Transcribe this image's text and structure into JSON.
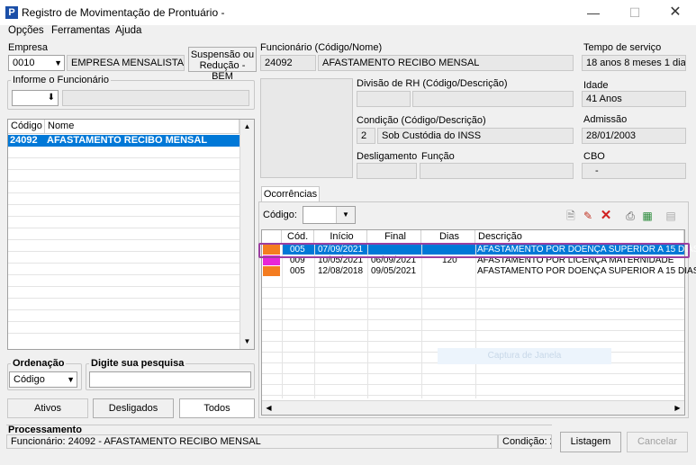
{
  "window": {
    "title": "Registro de Movimentação de Prontuário -",
    "app_letter": "P"
  },
  "menu": [
    "Opções",
    "Ferramentas",
    "Ajuda"
  ],
  "empresa": {
    "label": "Empresa",
    "code": "0010",
    "name": "EMPRESA MENSALISTA"
  },
  "suspensao_button": {
    "line1": "Suspensão ou",
    "line2": "Redução - BEM"
  },
  "funcionario": {
    "label": "Funcionário (Código/Nome)",
    "code": "24092",
    "name": "AFASTAMENTO RECIBO MENSAL"
  },
  "tempo_servico": {
    "label": "Tempo de serviço",
    "value": "18 anos 8 meses 1 dia"
  },
  "informe": {
    "label": "Informe o Funcionário"
  },
  "divisao": {
    "label": "Divisão de RH (Código/Descrição)"
  },
  "idade": {
    "label": "Idade",
    "value": "41 Anos"
  },
  "condicao": {
    "label": "Condição (Código/Descrição)",
    "code": "2",
    "desc": "Sob Custódia do INSS"
  },
  "admissao": {
    "label": "Admissão",
    "value": "28/01/2003"
  },
  "desligamento": {
    "label": "Desligamento"
  },
  "funcao": {
    "label": "Função"
  },
  "cbo": {
    "label": "CBO",
    "value": "-"
  },
  "employee_list": {
    "headers": [
      "Código",
      "Nome"
    ],
    "rows": [
      {
        "code": "24092",
        "name": "AFASTAMENTO RECIBO MENSAL"
      }
    ]
  },
  "ordenacao": {
    "label": "Ordenação",
    "value": "Código"
  },
  "pesquisa": {
    "label": "Digite sua pesquisa"
  },
  "filter_buttons": [
    "Ativos",
    "Desligados",
    "Todos"
  ],
  "ocorrencias": {
    "tab": "Ocorrências",
    "codigo_label": "Código:",
    "headers": [
      "Cód.",
      "Início",
      "Final",
      "Dias",
      "Descrição"
    ],
    "rows": [
      {
        "color": "#f47c20",
        "cod": "005",
        "inicio": "07/09/2021",
        "final": "",
        "dias": "",
        "desc": "AFASTAMENTO POR DOENÇA SUPERIOR A 15 DIAS"
      },
      {
        "color": "#e826d6",
        "cod": "009",
        "inicio": "10/05/2021",
        "final": "06/09/2021",
        "dias": "120",
        "desc": "AFASTAMENTO POR LICENÇA MATERNIDADE"
      },
      {
        "color": "#f47c20",
        "cod": "005",
        "inicio": "12/08/2018",
        "final": "09/05/2021",
        "dias": "",
        "desc": "AFASTAMENTO POR DOENÇA SUPERIOR A 15 DIAS"
      }
    ],
    "watermark": "Captura de Janela"
  },
  "processamento": {
    "label": "Processamento",
    "status": "Funcionário: 24092 - AFASTAMENTO RECIBO MENSAL",
    "condicao": "Condição: 2"
  },
  "listagem_button": "Listagem",
  "cancelar_button": "Cancelar"
}
